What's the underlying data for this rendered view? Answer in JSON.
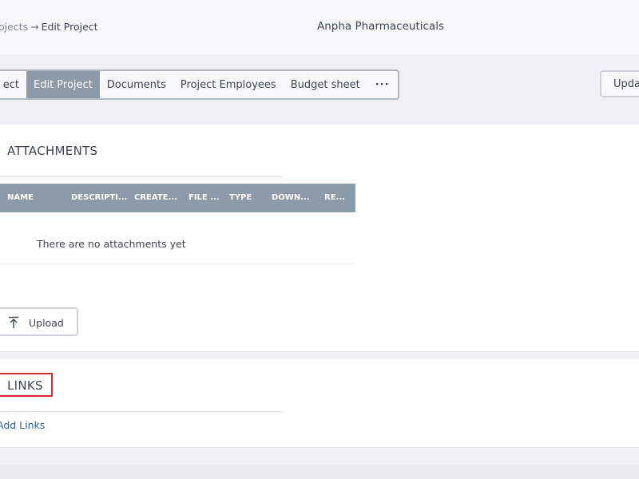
{
  "header": {
    "breadcrumb_link": "ojects",
    "breadcrumb_sep": "→",
    "breadcrumb_current": "Edit Project",
    "company": "Anpha Pharmaceuticals"
  },
  "tabs": [
    {
      "label": "ect",
      "active": false
    },
    {
      "label": "Edit Project",
      "active": true
    },
    {
      "label": "Documents",
      "active": false
    },
    {
      "label": "Project Employees",
      "active": false
    },
    {
      "label": "Budget sheet",
      "active": false
    },
    {
      "label": "···",
      "active": false
    }
  ],
  "actions": {
    "update_label": "Upda"
  },
  "attachments": {
    "title": "ATTACHMENTS",
    "columns": [
      "NAME",
      "DESCRIPTI...",
      "CREATE...",
      "FILE ...",
      "TYPE",
      "DOWN...",
      "RE..."
    ],
    "empty_text": "There are no attachments yet",
    "upload_label": "Upload"
  },
  "links": {
    "title": "LINKS",
    "add_label": "Add Links"
  },
  "colors": {
    "accent": "#8d9aa8",
    "highlight_border": "#d62a2a",
    "link": "#2f5f8a"
  },
  "icons": {
    "upload": "upload-arrow-icon",
    "more": "more-icon"
  }
}
